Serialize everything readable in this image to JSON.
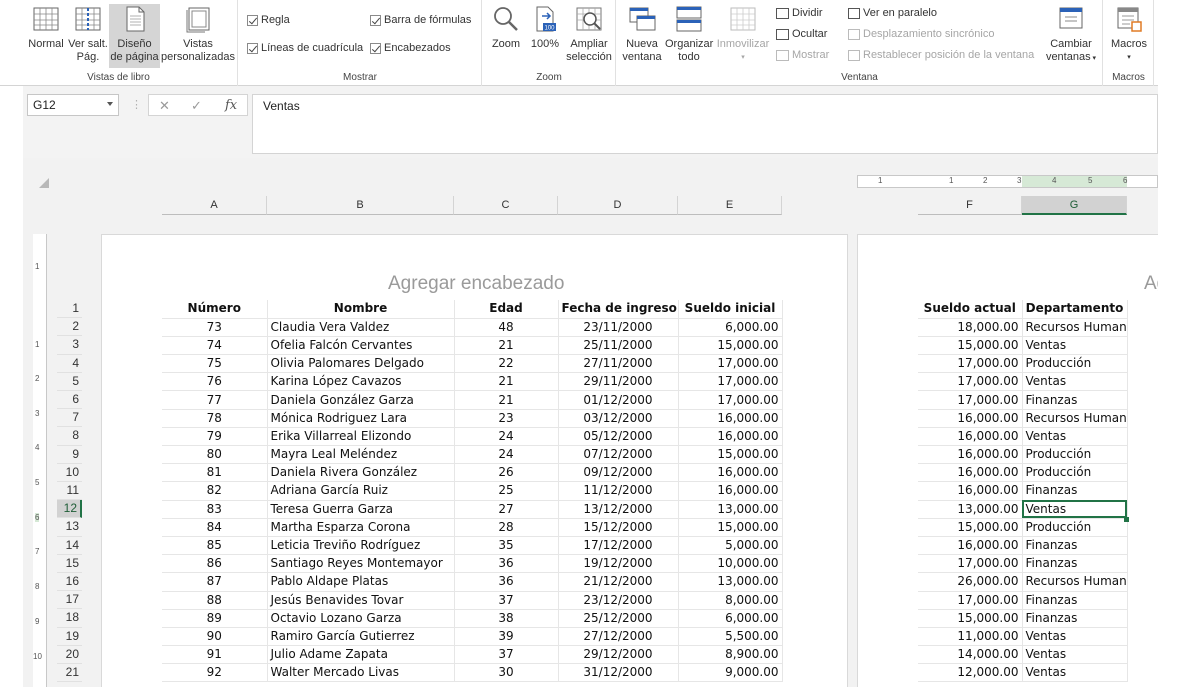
{
  "ribbon": {
    "workbook_views": {
      "label": "Vistas de libro",
      "buttons": [
        {
          "line1": "Normal",
          "line2": ""
        },
        {
          "line1": "Ver salt.",
          "line2": "Pág."
        },
        {
          "line1": "Diseño",
          "line2": "de página"
        },
        {
          "line1": "Vistas",
          "line2": "personalizadas"
        }
      ]
    },
    "show": {
      "label": "Mostrar",
      "ruler": "Regla",
      "formula_bar": "Barra de fórmulas",
      "gridlines": "Líneas de cuadrícula",
      "headings": "Encabezados"
    },
    "zoom": {
      "label": "Zoom",
      "zoom": "Zoom",
      "hundred": "100%",
      "hundred_icon": "100",
      "zoom_sel_line1": "Ampliar",
      "zoom_sel_line2": "selección"
    },
    "window": {
      "label": "Ventana",
      "new_line1": "Nueva",
      "new_line2": "ventana",
      "arrange_line1": "Organizar",
      "arrange_line2": "todo",
      "freeze": "Inmovilizar",
      "split": "Dividir",
      "hide": "Ocultar",
      "unhide": "Mostrar",
      "side_by_side": "Ver en paralelo",
      "sync_scroll": "Desplazamiento sincrónico",
      "reset_pos": "Restablecer posición de la ventana",
      "switch_line1": "Cambiar",
      "switch_line2": "ventanas"
    },
    "macros": {
      "label": "Macros",
      "button": "Macros"
    }
  },
  "formula_bar": {
    "name_box": "G12",
    "cancel": "✕",
    "enter": "✓",
    "fx": "fx",
    "content": "Ventas"
  },
  "columns_left": [
    "A",
    "B",
    "C",
    "D",
    "E"
  ],
  "columns_right": [
    "F",
    "G"
  ],
  "page": {
    "header_placeholder": "Agregar encabezado",
    "header_placeholder_right": "Ag"
  },
  "ruler_numbers": [
    "1",
    "1",
    "2",
    "3",
    "4",
    "5",
    "6"
  ],
  "vruler_numbers": [
    "1",
    "1",
    "2",
    "3",
    "4",
    "5",
    "6",
    "7",
    "8",
    "9",
    "10"
  ],
  "table_left": {
    "headers": [
      "Número",
      "Nombre",
      "Edad",
      "Fecha de ingreso",
      "Sueldo inicial"
    ],
    "rows": [
      [
        "73",
        "Claudia Vera Valdez",
        "48",
        "23/11/2000",
        "6,000.00"
      ],
      [
        "74",
        "Ofelia Falcón Cervantes",
        "21",
        "25/11/2000",
        "15,000.00"
      ],
      [
        "75",
        "Olivia Palomares Delgado",
        "22",
        "27/11/2000",
        "17,000.00"
      ],
      [
        "76",
        "Karina López Cavazos",
        "21",
        "29/11/2000",
        "17,000.00"
      ],
      [
        "77",
        "Daniela González Garza",
        "21",
        "01/12/2000",
        "17,000.00"
      ],
      [
        "78",
        "Mónica Rodriguez Lara",
        "23",
        "03/12/2000",
        "16,000.00"
      ],
      [
        "79",
        "Erika Villarreal Elizondo",
        "24",
        "05/12/2000",
        "16,000.00"
      ],
      [
        "80",
        "Mayra Leal Meléndez",
        "24",
        "07/12/2000",
        "15,000.00"
      ],
      [
        "81",
        "Daniela Rivera González",
        "26",
        "09/12/2000",
        "16,000.00"
      ],
      [
        "82",
        "Adriana García Ruiz",
        "25",
        "11/12/2000",
        "16,000.00"
      ],
      [
        "83",
        "Teresa Guerra Garza",
        "27",
        "13/12/2000",
        "13,000.00"
      ],
      [
        "84",
        "Martha Esparza Corona",
        "28",
        "15/12/2000",
        "15,000.00"
      ],
      [
        "85",
        "Leticia Treviño Rodríguez",
        "35",
        "17/12/2000",
        "5,000.00"
      ],
      [
        "86",
        "Santiago Reyes Montemayor",
        "36",
        "19/12/2000",
        "10,000.00"
      ],
      [
        "87",
        "Pablo Aldape Platas",
        "36",
        "21/12/2000",
        "13,000.00"
      ],
      [
        "88",
        "Jesús Benavides Tovar",
        "37",
        "23/12/2000",
        "8,000.00"
      ],
      [
        "89",
        "Octavio Lozano Garza",
        "38",
        "25/12/2000",
        "6,000.00"
      ],
      [
        "90",
        "Ramiro García Gutierrez",
        "39",
        "27/12/2000",
        "5,500.00"
      ],
      [
        "91",
        "Julio Adame Zapata",
        "37",
        "29/12/2000",
        "8,900.00"
      ],
      [
        "92",
        "Walter Mercado Livas",
        "30",
        "31/12/2000",
        "9,000.00"
      ]
    ]
  },
  "table_right": {
    "headers": [
      "Sueldo actual",
      "Departamento"
    ],
    "rows": [
      [
        "18,000.00",
        "Recursos Humanos"
      ],
      [
        "15,000.00",
        "Ventas"
      ],
      [
        "17,000.00",
        "Producción"
      ],
      [
        "17,000.00",
        "Ventas"
      ],
      [
        "17,000.00",
        "Finanzas"
      ],
      [
        "16,000.00",
        "Recursos Humanos"
      ],
      [
        "16,000.00",
        "Ventas"
      ],
      [
        "16,000.00",
        "Producción"
      ],
      [
        "16,000.00",
        "Producción"
      ],
      [
        "16,000.00",
        "Finanzas"
      ],
      [
        "13,000.00",
        "Ventas"
      ],
      [
        "15,000.00",
        "Producción"
      ],
      [
        "16,000.00",
        "Finanzas"
      ],
      [
        "17,000.00",
        "Finanzas"
      ],
      [
        "26,000.00",
        "Recursos Humanos"
      ],
      [
        "17,000.00",
        "Finanzas"
      ],
      [
        "15,000.00",
        "Finanzas"
      ],
      [
        "11,000.00",
        "Ventas"
      ],
      [
        "14,000.00",
        "Ventas"
      ],
      [
        "12,000.00",
        "Ventas"
      ]
    ]
  },
  "row_numbers": [
    "1",
    "2",
    "3",
    "4",
    "5",
    "6",
    "7",
    "8",
    "9",
    "10",
    "11",
    "12",
    "13",
    "14",
    "15",
    "16",
    "17",
    "18",
    "19",
    "20",
    "21"
  ],
  "selected_row": "12",
  "selected_column": "G",
  "colors": {
    "accent": "#217346",
    "selection_header": "#d2d2d2"
  }
}
